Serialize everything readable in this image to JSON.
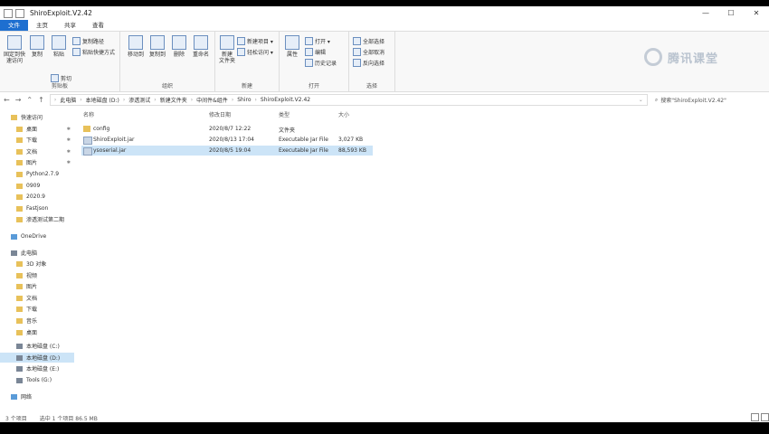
{
  "window": {
    "title": "ShiroExploit.V2.42",
    "controls": [
      "—",
      "☐",
      "✕"
    ]
  },
  "ribbon_tabs": [
    "文件",
    "主页",
    "共享",
    "查看"
  ],
  "ribbon": {
    "clipboard": {
      "pin": "固定到快速访问",
      "copy": "复制",
      "paste": "粘贴",
      "cut": "剪切",
      "copy_path": "复制路径",
      "paste_shortcut": "粘贴快捷方式",
      "label": "剪贴板"
    },
    "organize": {
      "move_to": "移动到",
      "copy_to": "复制到",
      "delete": "删除",
      "rename": "重命名",
      "label": "组织"
    },
    "new": {
      "new_folder": "新建\n文件夹",
      "new_item": "新建项目 ▾",
      "easy_access": "轻松访问 ▾",
      "label": "新建"
    },
    "open": {
      "properties": "属性",
      "open": "打开 ▾",
      "edit": "编辑",
      "history": "历史记录",
      "label": "打开"
    },
    "select": {
      "select_all": "全部选择",
      "select_none": "全部取消",
      "invert": "反向选择",
      "label": "选择"
    }
  },
  "logo_text": "腾讯课堂",
  "address": {
    "nav": [
      "←",
      "→",
      "⌃",
      "↑"
    ],
    "crumbs": [
      "此电脑",
      "本地磁盘 (D:)",
      "渗透测试",
      "新建文件夹",
      "中间件&组件",
      "Shiro",
      "ShiroExploit.V2.42"
    ],
    "search_placeholder": "搜索\"ShiroExploit.V2.42\""
  },
  "sidebar": [
    {
      "label": "快速访问",
      "icon": "star-icon",
      "pinned": false
    },
    {
      "label": "桌面",
      "icon": "desktop-icon",
      "pinned": true
    },
    {
      "label": "下载",
      "icon": "download-icon",
      "pinned": true
    },
    {
      "label": "文档",
      "icon": "document-icon",
      "pinned": true
    },
    {
      "label": "图片",
      "icon": "picture-icon",
      "pinned": true
    },
    {
      "label": "Python2.7.9",
      "icon": "folder-icon",
      "pinned": false
    },
    {
      "label": "0909",
      "icon": "folder-icon",
      "pinned": false
    },
    {
      "label": "2020.9",
      "icon": "folder-icon",
      "pinned": false
    },
    {
      "label": "Fastjson",
      "icon": "folder-icon",
      "pinned": false
    },
    {
      "label": "渗透测试第二期",
      "icon": "folder-icon",
      "pinned": false
    },
    {
      "label": "OneDrive",
      "icon": "cloud-icon",
      "pinned": false
    },
    {
      "label": "此电脑",
      "icon": "computer-icon",
      "pinned": false
    },
    {
      "label": "3D 对象",
      "icon": "cube-icon",
      "pinned": false
    },
    {
      "label": "视频",
      "icon": "video-icon",
      "pinned": false
    },
    {
      "label": "图片",
      "icon": "picture-icon",
      "pinned": false
    },
    {
      "label": "文档",
      "icon": "document-icon",
      "pinned": false
    },
    {
      "label": "下载",
      "icon": "download-icon",
      "pinned": false
    },
    {
      "label": "音乐",
      "icon": "music-icon",
      "pinned": false
    },
    {
      "label": "桌面",
      "icon": "desktop-icon",
      "pinned": false
    },
    {
      "label": "本地磁盘 (C:)",
      "icon": "drive-icon",
      "pinned": false
    },
    {
      "label": "本地磁盘 (D:)",
      "icon": "drive-icon",
      "pinned": false,
      "selected": true
    },
    {
      "label": "本地磁盘 (E:)",
      "icon": "drive-icon",
      "pinned": false
    },
    {
      "label": "Tools (G:)",
      "icon": "drive-icon",
      "pinned": false
    },
    {
      "label": "网络",
      "icon": "network-icon",
      "pinned": false
    }
  ],
  "columns": [
    "名称",
    "修改日期",
    "类型",
    "大小"
  ],
  "files": [
    {
      "name": "config",
      "date": "2020/8/7 12:22",
      "type": "文件夹",
      "size": "",
      "icon": "folder-icon"
    },
    {
      "name": "ShiroExploit.jar",
      "date": "2020/8/13 17:04",
      "type": "Executable Jar File",
      "size": "3,027 KB",
      "icon": "jar-icon"
    },
    {
      "name": "ysoserial.jar",
      "date": "2020/8/5 19:04",
      "type": "Executable Jar File",
      "size": "88,593 KB",
      "icon": "jar-icon",
      "selected": true
    }
  ],
  "status": {
    "count": "3 个项目",
    "selected": "选中 1 个项目 86.5 MB"
  }
}
